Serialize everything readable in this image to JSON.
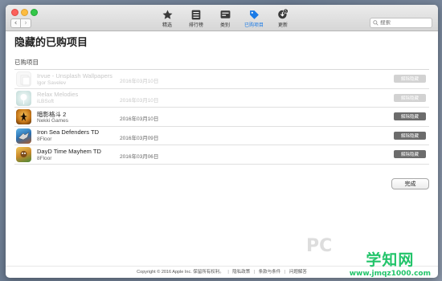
{
  "toolbar": {
    "items": [
      {
        "label": "精选",
        "icon": "star-icon"
      },
      {
        "label": "排行榜",
        "icon": "list-icon"
      },
      {
        "label": "类别",
        "icon": "box-icon"
      },
      {
        "label": "已购项目",
        "icon": "tag-icon",
        "active": true
      },
      {
        "label": "更新",
        "icon": "update-icon",
        "badge": "5"
      }
    ]
  },
  "search": {
    "placeholder": "搜索"
  },
  "page": {
    "title": "隐藏的已购项目",
    "section": "已购项目"
  },
  "apps": [
    {
      "name": "Irvue - Unsplash Wallpapers",
      "developer": "Igor Savelev",
      "date": "2016年03月10日",
      "button": "解除隐藏",
      "faded": true
    },
    {
      "name": "Relax Melodies",
      "developer": "iLBSoft",
      "date": "2016年03月10日",
      "button": "解除隐藏",
      "faded": true
    },
    {
      "name": "暗影格斗 2",
      "developer": "Nekki Games",
      "date": "2016年03月10日",
      "button": "解除隐藏",
      "faded": false
    },
    {
      "name": "Iron Sea Defenders TD",
      "developer": "8Floor",
      "date": "2016年03月09日",
      "button": "解除隐藏",
      "faded": false
    },
    {
      "name": "DayD Time Mayhem TD",
      "developer": "8Floor",
      "date": "2016年03月06日",
      "button": "解除隐藏",
      "faded": false
    }
  ],
  "done_label": "完成",
  "footer": {
    "copyright": "Copyright © 2016 Apple Inc. 保留所有权利。",
    "links": [
      "隐私政策",
      "条款与条件",
      "问题解答"
    ]
  },
  "watermark": {
    "brand": "学知网",
    "url": "www.jmqz1000.com",
    "ghost": "PC"
  },
  "colors": {
    "accent": "#1a7ae6",
    "watermark": "#22c46a"
  }
}
